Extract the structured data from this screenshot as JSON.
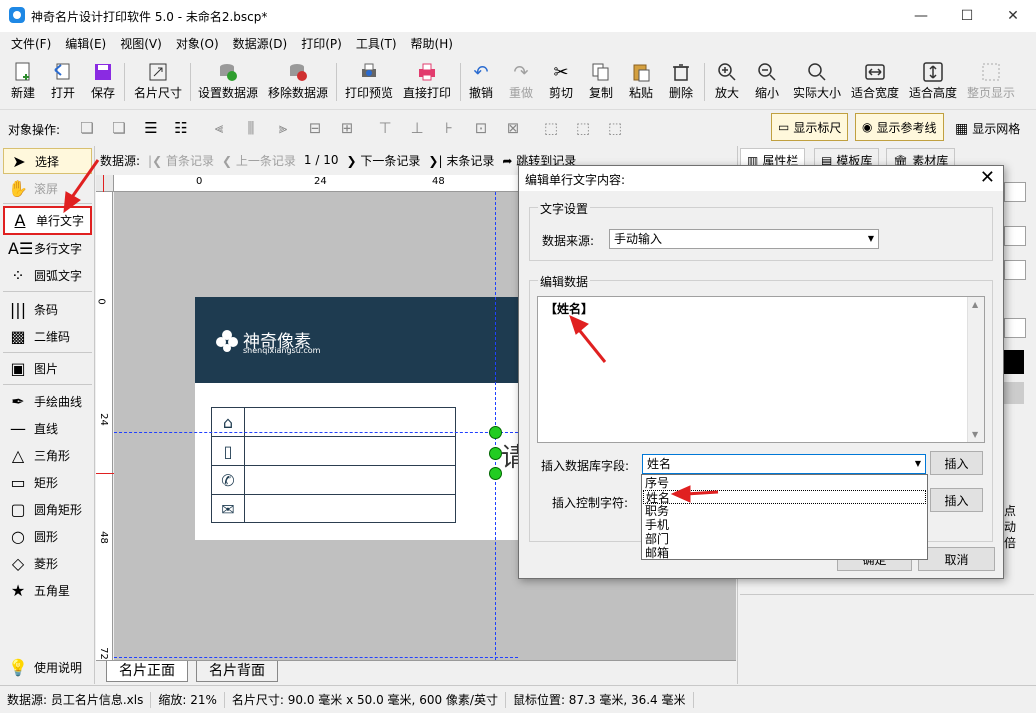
{
  "window": {
    "title": "神奇名片设计打印软件 5.0 - 未命名2.bscp*",
    "minimize": "—",
    "maximize": "☐",
    "close": "✕"
  },
  "menu": [
    "文件(F)",
    "编辑(E)",
    "视图(V)",
    "对象(O)",
    "数据源(D)",
    "打印(P)",
    "工具(T)",
    "帮助(H)"
  ],
  "toolbar": {
    "new": "新建",
    "open": "打开",
    "save": "保存",
    "card_size": "名片尺寸",
    "set_datasource": "设置数据源",
    "remove_datasource": "移除数据源",
    "print_preview": "打印预览",
    "direct_print": "直接打印",
    "undo": "撤销",
    "redo": "重做",
    "cut": "剪切",
    "copy": "复制",
    "paste": "粘贴",
    "delete": "删除",
    "zoom_in": "放大",
    "zoom_out": "缩小",
    "actual_size": "实际大小",
    "fit_width": "适合宽度",
    "fit_height": "适合高度",
    "full_page": "整页显示"
  },
  "objbar": {
    "label": "对象操作:",
    "show_ruler": "显示标尺",
    "show_guides": "显示参考线",
    "show_grid": "显示网格"
  },
  "tools": {
    "select": "选择",
    "scroll": "滚屏",
    "single_text": "单行文字",
    "multi_text": "多行文字",
    "arc_text": "圆弧文字",
    "barcode": "条码",
    "qrcode": "二维码",
    "image": "图片",
    "freehand": "手绘曲线",
    "line": "直线",
    "triangle": "三角形",
    "rect": "矩形",
    "round_rect": "圆角矩形",
    "circle": "圆形",
    "diamond": "菱形",
    "star": "五角星",
    "help": "使用说明"
  },
  "nav": {
    "datasource_label": "数据源:",
    "first": "首条记录",
    "prev": "上一条记录",
    "counter": "1 / 10",
    "next": "下一条记录",
    "last": "末条记录",
    "jump": "跳转到记录"
  },
  "ruler": {
    "h": [
      "0",
      "24",
      "48"
    ],
    "v": [
      "0",
      "24",
      "48",
      "72"
    ]
  },
  "card": {
    "brand_cn": "神奇像素",
    "brand_en": "shenqixiangsu.com",
    "placeholder_char": "请"
  },
  "page_tabs": [
    "名片正面",
    "名片背面"
  ],
  "right_tabs": [
    "属性栏",
    "模板库",
    "素材库"
  ],
  "right_partial": [
    "点",
    "动",
    "倍"
  ],
  "status": {
    "datasource": "数据源: 员工名片信息.xls",
    "zoom": "缩放: 21%",
    "card_size": "名片尺寸: 90.0 毫米 x 50.0 毫米, 600 像素/英寸",
    "mouse_pos": "鼠标位置: 87.3 毫米, 36.4 毫米"
  },
  "dialog": {
    "title": "编辑单行文字内容:",
    "text_settings": "文字设置",
    "data_source_label": "数据来源:",
    "data_source_value": "手动输入",
    "edit_data": "编辑数据",
    "edit_content": "【姓名】",
    "insert_field_label": "插入数据库字段:",
    "insert_field_value": "姓名",
    "insert_button": "插入",
    "insert_control_label": "插入控制字符:",
    "insert_button2": "插入",
    "ok": "确定",
    "cancel": "取消",
    "field_options": [
      "序号",
      "姓名",
      "职务",
      "手机",
      "部门",
      "邮箱"
    ]
  }
}
